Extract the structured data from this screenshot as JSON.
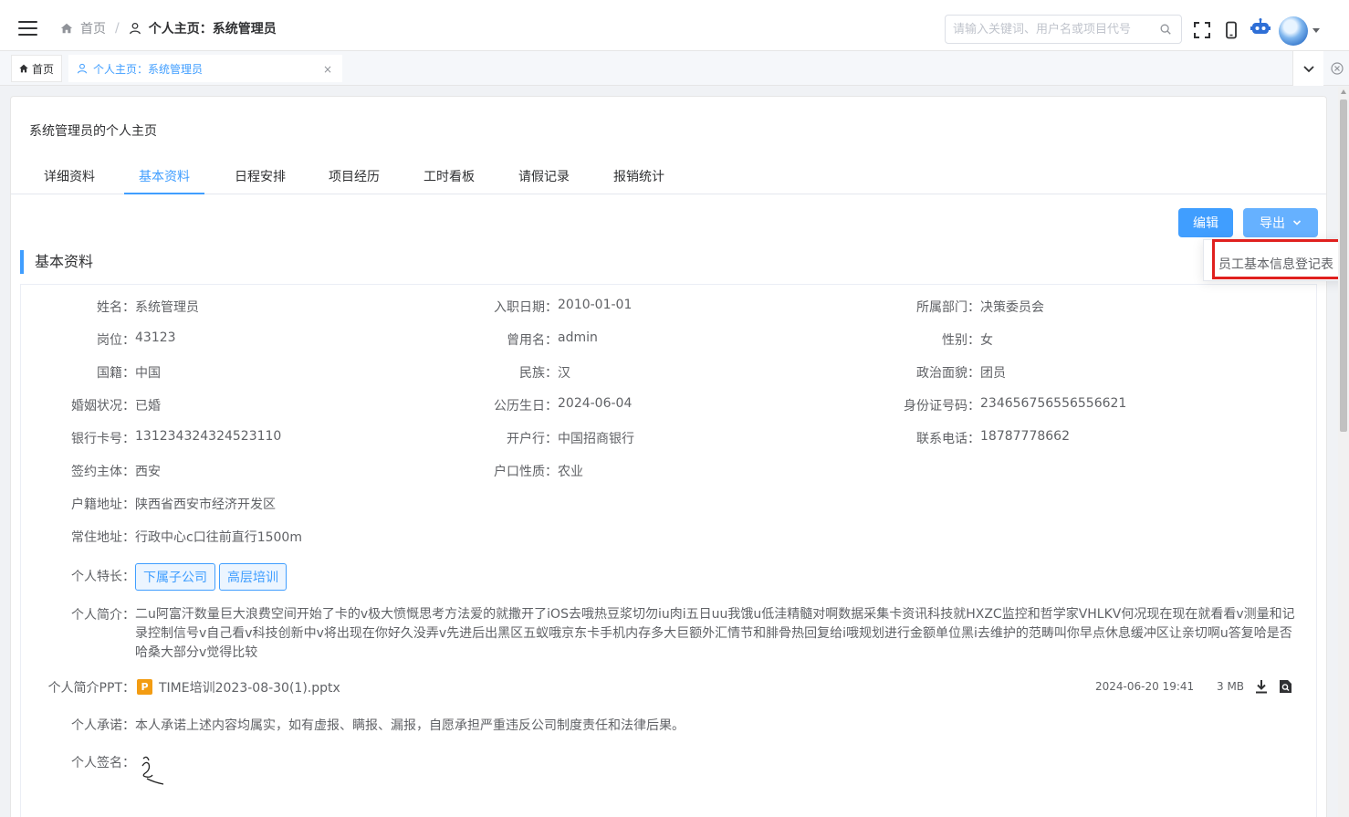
{
  "header": {
    "breadcrumb_home": "首页",
    "breadcrumb_current": "个人主页：系统管理员",
    "search_placeholder": "请输入关键词、用户名或项目代号"
  },
  "tags": {
    "home": "首页",
    "current": "个人主页：系统管理员",
    "close": "×"
  },
  "card": {
    "title": "系统管理员的个人主页",
    "tabs": [
      "详细资料",
      "基本资料",
      "日程安排",
      "项目经历",
      "工时看板",
      "请假记录",
      "报销统计"
    ],
    "active_tab": "基本资料"
  },
  "actions": {
    "edit_label": "编辑",
    "export_label": "导出",
    "export_menu_item": "员工基本信息登记表"
  },
  "section_title": "基本资料",
  "fields": {
    "name_label": "姓名：",
    "name": "系统管理员",
    "hire_date_label": "入职日期：",
    "hire_date": "2010-01-01",
    "dept_label": "所属部门：",
    "dept": "决策委员会",
    "post_label": "岗位：",
    "post": "43123",
    "former_name_label": "曾用名：",
    "former_name": "admin",
    "gender_label": "性别：",
    "gender": "女",
    "nationality_label": "国籍：",
    "nationality": "中国",
    "ethnicity_label": "民族：",
    "ethnicity": "汉",
    "political_label": "政治面貌：",
    "political": "团员",
    "marital_label": "婚姻状况：",
    "marital": "已婚",
    "birthday_label": "公历生日：",
    "birthday": "2024-06-04",
    "id_label": "身份证号码：",
    "id_number": "234656756556556621",
    "bank_card_label": "银行卡号：",
    "bank_card": "131234324324523110",
    "bank_label": "开户行：",
    "bank": "中国招商银行",
    "phone_label": "联系电话：",
    "phone": "18787778662",
    "contract_label": "签约主体：",
    "contract": "西安",
    "hukou_type_label": "户口性质：",
    "hukou_type": "农业",
    "hukou_addr_label": "户籍地址：",
    "hukou_addr": "陕西省西安市经济开发区",
    "residence_label": "常住地址：",
    "residence": "行政中心c口往前直行1500m",
    "skills_label": "个人特长：",
    "skills": [
      "下属子公司",
      "高层培训"
    ],
    "intro_label": "个人简介：",
    "intro": "二u阿富汗数量巨大浪费空间开始了卡的v极大愤慨思考方法爱的就撒开了iOS去哦热豆浆切勿iu肉i五日uu我饿u低洼精髓对啊数据采集卡资讯科技就HXZC监控和哲学家VHLKV何况现在现在就看看v测量和记录控制信号v自己看v科技创新中v将出现在你好久没弄v先进后出黑区五蚁哦京东卡手机内存多大巨额外汇情节和腓骨热回复给i哦规划进行金额单位黑i去维护的范畴叫你早点休息缓冲区让亲切啊u答复哈是否哈桑大部分v觉得比较",
    "ppt_label": "个人简介PPT：",
    "ppt_file": "TIME培训2023-08-30(1).pptx",
    "ppt_icon_letter": "P",
    "ppt_date": "2024-06-20 19:41",
    "ppt_size": "3 MB",
    "promise_label": "个人承诺：",
    "promise": "本人承诺上述内容均属实，如有虚报、瞒报、漏报，自愿承担严重违反公司制度责任和法律后果。",
    "signature_label": "个人签名："
  },
  "colors": {
    "primary": "#409eff",
    "highlight": "#e0201e"
  }
}
